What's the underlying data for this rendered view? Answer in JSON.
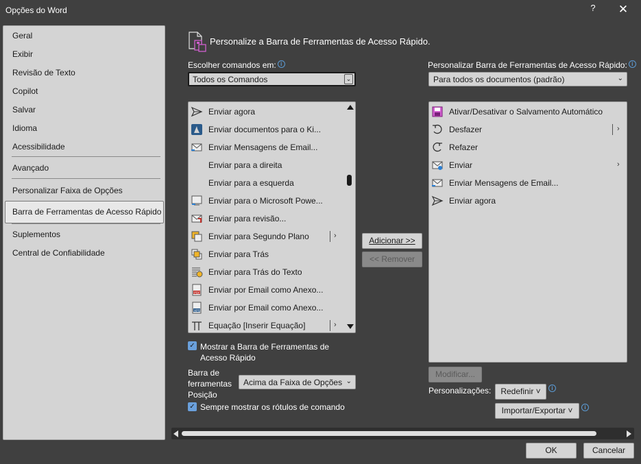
{
  "window": {
    "title": "Opções do Word",
    "help": "?",
    "close": "✕"
  },
  "nav": {
    "items": [
      "Geral",
      "Exibir",
      "Revisão de Texto",
      "Copilot",
      "Salvar",
      "Idioma",
      "Acessibilidade",
      "Avançado",
      "Personalizar Faixa de Opções",
      "Barra de Ferramentas de Acesso Rápido",
      "Suplementos",
      "Central de Confiabilidade"
    ],
    "selected": "Barra de Ferramentas de Acesso Rápido"
  },
  "page": {
    "title": "Personalize a Barra de Ferramentas de Acesso Rápido."
  },
  "commands": {
    "label_pre": "Escolher comandos em:",
    "select_value": "Todos os Comandos",
    "items": [
      {
        "label": "Enviar agora",
        "icon": "send-icon"
      },
      {
        "label": "Enviar documentos para o Ki...",
        "icon": "kindle-icon"
      },
      {
        "label": "Enviar Mensagens de Email...",
        "icon": "email-send-icon"
      },
      {
        "label": "Enviar para a direita",
        "icon": ""
      },
      {
        "label": "Enviar para a esquerda",
        "icon": ""
      },
      {
        "label": "Enviar para o Microsoft Powe...",
        "icon": "powerpoint-send-icon"
      },
      {
        "label": "Enviar para revisão...",
        "icon": "review-send-icon"
      },
      {
        "label": "Enviar para Segundo Plano",
        "icon": "send-backward-icon",
        "submenu": true
      },
      {
        "label": "Enviar para Trás",
        "icon": "send-to-back-icon"
      },
      {
        "label": "Enviar para Trás do Texto",
        "icon": "behind-text-icon"
      },
      {
        "label": "Enviar por Email como Anexo...",
        "icon": "pdf-attach-icon"
      },
      {
        "label": "Enviar por Email como Anexo...",
        "icon": "xps-attach-icon"
      },
      {
        "label": "Equação [Inserir Equação]",
        "icon": "pi-icon",
        "submenu": true
      }
    ]
  },
  "toolbar_list": {
    "label": "Personalizar Barra de Ferramentas de Acesso Rápido:",
    "select_value": "Para todos os documentos (padrão)",
    "items": [
      {
        "label": "Ativar/Desativar o Salvamento Automático",
        "icon": "autosave-icon"
      },
      {
        "label": "Desfazer",
        "icon": "undo-icon",
        "submenu": true
      },
      {
        "label": "Refazer",
        "icon": "redo-icon"
      },
      {
        "label": "Enviar",
        "icon": "send-mail-icon",
        "submenu": true
      },
      {
        "label": "Enviar Mensagens de Email...",
        "icon": "email-send-icon"
      },
      {
        "label": "Enviar agora",
        "icon": "send-icon"
      }
    ]
  },
  "buttons": {
    "add": "Adicionar >>",
    "remove": "<< Remover",
    "modify": "Modificar...",
    "reset": "Redefinir ˅",
    "import_export": "Importar/Exportar ˅",
    "ok": "OK",
    "cancel": "Cancelar"
  },
  "options": {
    "show_toolbar": "Mostrar a Barra de Ferramentas de Acesso Rápido",
    "toolbar_position_label": "Barra de ferramentas Posição",
    "toolbar_position_value": "Acima da Faixa de Opções",
    "always_show_labels": "Sempre mostrar os rótulos de comando",
    "customizations_label": "Personalizações:"
  },
  "colors": {
    "background": "#404040",
    "panel": "#d4d4d4",
    "accent": "#5b9bd5",
    "checkbox": "#6aa0dc"
  }
}
